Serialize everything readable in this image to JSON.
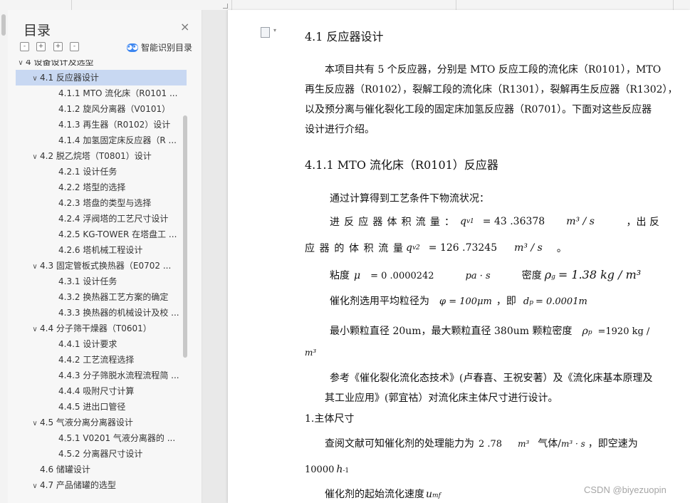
{
  "toc": {
    "title": "目录",
    "close_icon": "×",
    "tools": [
      "-",
      "+",
      "+",
      "-"
    ],
    "smart_label": "智能识别目录",
    "items": [
      {
        "label": "4 设备设计及选型",
        "level": 0,
        "toggle": "∨",
        "active": false
      },
      {
        "label": "4.1 反应器设计",
        "level": 1,
        "toggle": "∨",
        "active": true
      },
      {
        "label": "4.1.1 MTO 流化床（R0101 ...",
        "level": 2,
        "toggle": "",
        "active": false
      },
      {
        "label": "4.1.2 旋风分离器（V0101）",
        "level": 2,
        "toggle": "",
        "active": false
      },
      {
        "label": "4.1.3 再生器（R0102）设计",
        "level": 2,
        "toggle": "",
        "active": false
      },
      {
        "label": "4.1.4 加氢固定床反应器（R ...",
        "level": 2,
        "toggle": "",
        "active": false
      },
      {
        "label": "4.2 脱乙烷塔（T0801）设计",
        "level": 1,
        "toggle": "∨",
        "active": false
      },
      {
        "label": "4.2.1 设计任务",
        "level": 2,
        "toggle": "",
        "active": false
      },
      {
        "label": "4.2.2 塔型的选择",
        "level": 2,
        "toggle": "",
        "active": false
      },
      {
        "label": "4.2.3 塔盘的类型与选择",
        "level": 2,
        "toggle": "",
        "active": false
      },
      {
        "label": "4.2.4 浮阀塔的工艺尺寸设计",
        "level": 2,
        "toggle": "",
        "active": false
      },
      {
        "label": "4.2.5 KG-TOWER 在塔盘工 ...",
        "level": 2,
        "toggle": "",
        "active": false
      },
      {
        "label": "4.2.6 塔机械工程设计",
        "level": 2,
        "toggle": "",
        "active": false
      },
      {
        "label": "4.3 固定管板式换热器（E0702 ...",
        "level": 1,
        "toggle": "∨",
        "active": false
      },
      {
        "label": "4.3.1 设计任务",
        "level": 2,
        "toggle": "",
        "active": false
      },
      {
        "label": "4.3.2 换热器工艺方案的确定",
        "level": 2,
        "toggle": "",
        "active": false
      },
      {
        "label": "4.3.3 换热器的机械设计及校 ...",
        "level": 2,
        "toggle": "",
        "active": false
      },
      {
        "label": "4.4 分子筛干燥器（T0601）",
        "level": 1,
        "toggle": "∨",
        "active": false
      },
      {
        "label": "4.4.1 设计要求",
        "level": 2,
        "toggle": "",
        "active": false
      },
      {
        "label": "4.4.2 工艺流程选择",
        "level": 2,
        "toggle": "",
        "active": false
      },
      {
        "label": "4.4.3 分子筛脱水流程流程简 ...",
        "level": 2,
        "toggle": "",
        "active": false
      },
      {
        "label": "4.4.4 吸附尺寸计算",
        "level": 2,
        "toggle": "",
        "active": false
      },
      {
        "label": "4.4.5 进出口管径",
        "level": 2,
        "toggle": "",
        "active": false
      },
      {
        "label": "4.5 气液分离分离器设计",
        "level": 1,
        "toggle": "∨",
        "active": false
      },
      {
        "label": "4.5.1 V0201 气液分离器的 ...",
        "level": 2,
        "toggle": "",
        "active": false
      },
      {
        "label": "4.5.2 分离器尺寸设计",
        "level": 2,
        "toggle": "",
        "active": false
      },
      {
        "label": "4.6 储罐设计",
        "level": 1,
        "toggle": "",
        "active": false
      },
      {
        "label": "4.7 产品储罐的选型",
        "level": 1,
        "toggle": "∨",
        "active": false
      }
    ]
  },
  "doc": {
    "heading1": "4.1 反应器设计",
    "para1": [
      "本项目共有 5 个反应器，分别是 MTO 反应工段的流化床（R0101），MTO",
      "再生反应器（R0102），裂解工段的流化床（R1301），裂解再生反应器（R1302），",
      "以及预分离与催化裂化工段的固定床加氢反应器（R0701）。下面对这些反应器",
      "设计进行介绍。"
    ],
    "heading2": "4.1.1 MTO 流化床（R0101）反应器",
    "intro": "通过计算得到工艺条件下物流状况：",
    "flow_in_label": [
      "进",
      "反",
      "应",
      "器",
      "体",
      "积",
      "流",
      "量",
      "："
    ],
    "flow_in_value": "= 43 .36378",
    "flow_unit": "m³ / s",
    "flow_in_tail": "，出 反",
    "flow_out_label": [
      "应",
      "器",
      "的",
      "体",
      "积",
      "流",
      "量"
    ],
    "flow_out_value": "= 126 .73245",
    "flow_out_tail": "。",
    "q_symbol": "q",
    "q_sub1": "v1",
    "q_sub2": "v2",
    "viscosity_label": "粘度",
    "mu": "μ",
    "viscosity_value": "= 0 .0000242",
    "viscosity_unit": "pa · s",
    "density_label": "密度",
    "rho": "ρ",
    "rho_sub": "g",
    "density_value": "= 1.38 kg / m³",
    "particle_text": "催化剂选用平均粒径为",
    "phi_eq": "φ = 100μm",
    "particle_mid": "，即",
    "dp_eq": "d",
    "dp_sub": "p",
    "dp_val": "= 0.0001m",
    "size_line": "最小颗粒直径 20um，最大颗粒直径 380um 颗粒密度",
    "rho_p": "ρ",
    "rho_p_sub": "p",
    "rho_p_val": "=1920 kg /",
    "m3": "m³",
    "ref_line1": "参考《催化裂化流化态技术》(卢春喜、王祝安著）及《流化床基本原理及",
    "ref_line2": "其工业应用》(郭宜祜）对流化床主体尺寸进行设计。",
    "section1": "1.主体尺寸",
    "cap_text": "查阅文献可知催化剂的处理能力为",
    "cap_value": "2 .78",
    "cap_unit": "m³",
    "cap_gas": "气体/",
    "cap_unit2": "m³ · s",
    "cap_tail": "，即空速为",
    "space_value": "10000",
    "space_unit": "h",
    "space_sup": "-1",
    "umf_text": "催化剂的起始流化速度",
    "umf_symbol": "u",
    "umf_sub": "mf"
  },
  "watermark": "CSDN @biyezuopin"
}
